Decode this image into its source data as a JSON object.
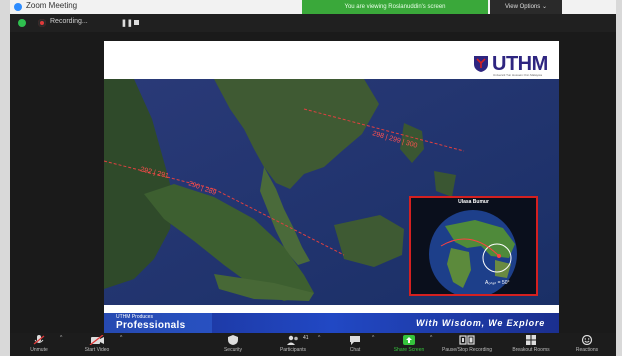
{
  "window": {
    "title": "Zoom Meeting"
  },
  "banner": {
    "share_text": "You are viewing Roslanuddin's screen",
    "view_options": "View Options ⌄"
  },
  "recording": {
    "label": "Recording..."
  },
  "slide": {
    "logo_text": "UTHM",
    "logo_sub": "Universiti Tun Hussein Onn Malaysia",
    "inset_title": "Ulasa Bumur",
    "inset_annotation": "A₀ₙₐₙ = 50°",
    "footer_small": "UTHM Produces",
    "footer_big": "Professionals",
    "motto": "With Wisdom, We Explore"
  },
  "toolbar": {
    "items": [
      {
        "label": "Unmute",
        "icon": "microphone-muted-icon"
      },
      {
        "label": "Start Video",
        "icon": "video-off-icon"
      },
      {
        "label": "Security",
        "icon": "shield-icon"
      },
      {
        "label": "Participants",
        "icon": "participants-icon",
        "count": "41"
      },
      {
        "label": "Chat",
        "icon": "chat-icon"
      },
      {
        "label": "Share Screen",
        "icon": "share-screen-icon"
      },
      {
        "label": "Pause/Stop Recording",
        "icon": "recording-icon"
      },
      {
        "label": "Breakout Rooms",
        "icon": "breakout-rooms-icon"
      },
      {
        "label": "Reactions",
        "icon": "reactions-icon"
      }
    ]
  },
  "colors": {
    "share_banner": "#3aa83a",
    "toolbar_bg": "#1c1c1c",
    "slide_footer": "#2148c4",
    "logo": "#2e2580",
    "inset_border": "#d42020"
  }
}
